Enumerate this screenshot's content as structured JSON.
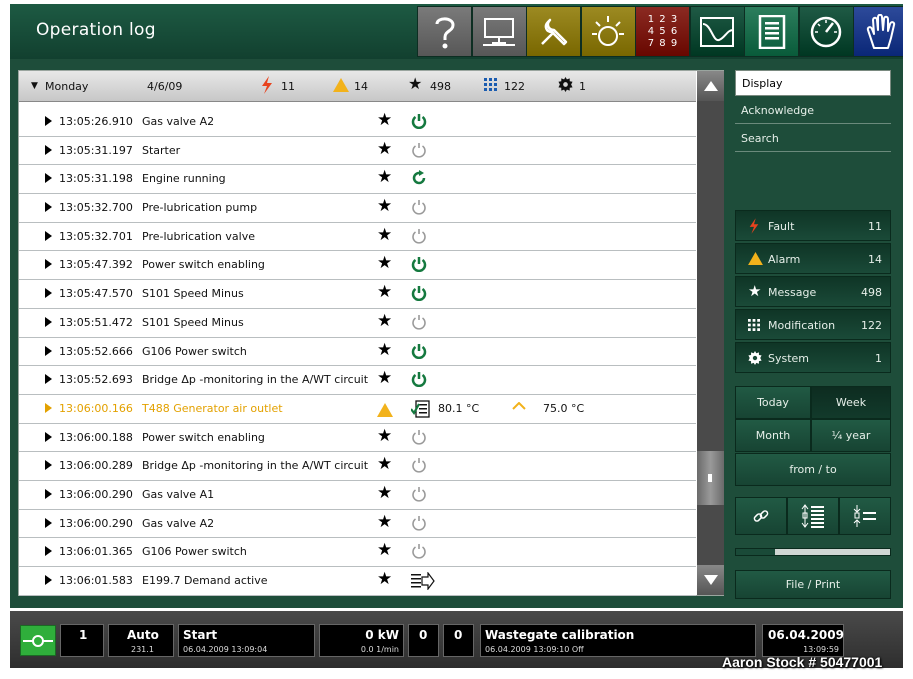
{
  "header": {
    "title": "Operation log",
    "numpad_label": "1 2 3 4 5 6 7 8 9"
  },
  "toolbar": [
    {
      "name": "help-button",
      "icon": "question-icon",
      "bg": "#7a7a7a"
    },
    {
      "name": "monitor-button",
      "icon": "monitor-icon",
      "bg": "#7a7a7a"
    },
    {
      "name": "maintenance-button",
      "icon": "wrench-icon",
      "bg": "#9c8a22"
    },
    {
      "name": "lamp-button",
      "icon": "lamp-icon",
      "bg": "#9c8a22"
    },
    {
      "name": "numpad-button",
      "icon": "numpad-icon",
      "bg": "#8b2a22"
    },
    {
      "name": "trend-button",
      "icon": "trend-icon",
      "bg": "#1f5a45"
    },
    {
      "name": "operation-log-button",
      "icon": "list-icon",
      "bg": "#2c7e5d"
    },
    {
      "name": "gauge-button",
      "icon": "gauge-icon",
      "bg": "#1f5a45"
    },
    {
      "name": "hand-button",
      "icon": "hand-icon",
      "bg": "#2d4a9a"
    }
  ],
  "day": {
    "label": "Monday",
    "date": "4/6/09",
    "fault": "11",
    "alarm": "14",
    "message": "498",
    "modification": "122",
    "system": "1"
  },
  "rows": [
    {
      "time": "13:05:26.910",
      "desc": "Gas valve A2",
      "icon": "power-on",
      "warn": false
    },
    {
      "time": "13:05:31.197",
      "desc": "Starter",
      "icon": "power-off",
      "warn": false
    },
    {
      "time": "13:05:31.198",
      "desc": "Engine running",
      "icon": "refresh",
      "warn": false
    },
    {
      "time": "13:05:32.700",
      "desc": "Pre-lubrication pump",
      "icon": "power-off",
      "warn": false
    },
    {
      "time": "13:05:32.701",
      "desc": "Pre-lubrication valve",
      "icon": "power-off",
      "warn": false
    },
    {
      "time": "13:05:47.392",
      "desc": "Power switch enabling",
      "icon": "power-on",
      "warn": false
    },
    {
      "time": "13:05:47.570",
      "desc": "S101 Speed Minus",
      "icon": "power-on",
      "warn": false
    },
    {
      "time": "13:05:51.472",
      "desc": "S101 Speed Minus",
      "icon": "power-off",
      "warn": false
    },
    {
      "time": "13:05:52.666",
      "desc": "G106 Power switch",
      "icon": "power-on",
      "warn": false
    },
    {
      "time": "13:05:52.693",
      "desc": "Bridge Δp -monitoring in the A/WT circuit",
      "icon": "power-on",
      "warn": false
    },
    {
      "time": "13:06:00.166",
      "desc": "T488 Generator air outlet",
      "icon": "checklist",
      "warn": true,
      "value": "80.1 °C",
      "limit": "75.0 °C"
    },
    {
      "time": "13:06:00.188",
      "desc": "Power switch enabling",
      "icon": "power-off",
      "warn": false
    },
    {
      "time": "13:06:00.289",
      "desc": "Bridge Δp -monitoring in the A/WT circuit",
      "icon": "power-off",
      "warn": false
    },
    {
      "time": "13:06:00.290",
      "desc": "Gas valve A1",
      "icon": "power-off",
      "warn": false
    },
    {
      "time": "13:06:00.290",
      "desc": "Gas valve A2",
      "icon": "power-off",
      "warn": false
    },
    {
      "time": "13:06:01.365",
      "desc": "G106 Power switch",
      "icon": "power-off",
      "warn": false
    },
    {
      "time": "13:06:01.583",
      "desc": "E199.7 Demand active",
      "icon": "export",
      "warn": false
    }
  ],
  "side": {
    "display": "Display",
    "acknowledge": "Acknowledge",
    "search": "Search",
    "fault_label": "Fault",
    "fault": "11",
    "alarm_label": "Alarm",
    "alarm": "14",
    "message_label": "Message",
    "message": "498",
    "modification_label": "Modification",
    "modification": "122",
    "system_label": "System",
    "system": "1",
    "today": "Today",
    "week": "Week",
    "month": "Month",
    "quarter": "¼ year",
    "fromto": "from / to",
    "fileprint": "File / Print"
  },
  "status": {
    "count": "1",
    "mode": "Auto",
    "mode_sub": "231.1",
    "state": "Start",
    "state_sub": "06.04.2009   13:09:04",
    "power": "0 kW",
    "speed": "0.0 1/min",
    "c1": "0",
    "c2": "0",
    "msg": "Wastegate calibration",
    "msg_sub": "06.04.2009 13:09:10 Off",
    "date": "06.04.2009",
    "time": "13:09:59"
  },
  "watermark": "Aaron Stock # 50477001",
  "colors": {
    "fault": "#e8431e",
    "alarm": "#f2b21b",
    "accent_green": "#15793f",
    "panel_bg": "#1e4d3a",
    "modification": "#1a5cb0"
  }
}
